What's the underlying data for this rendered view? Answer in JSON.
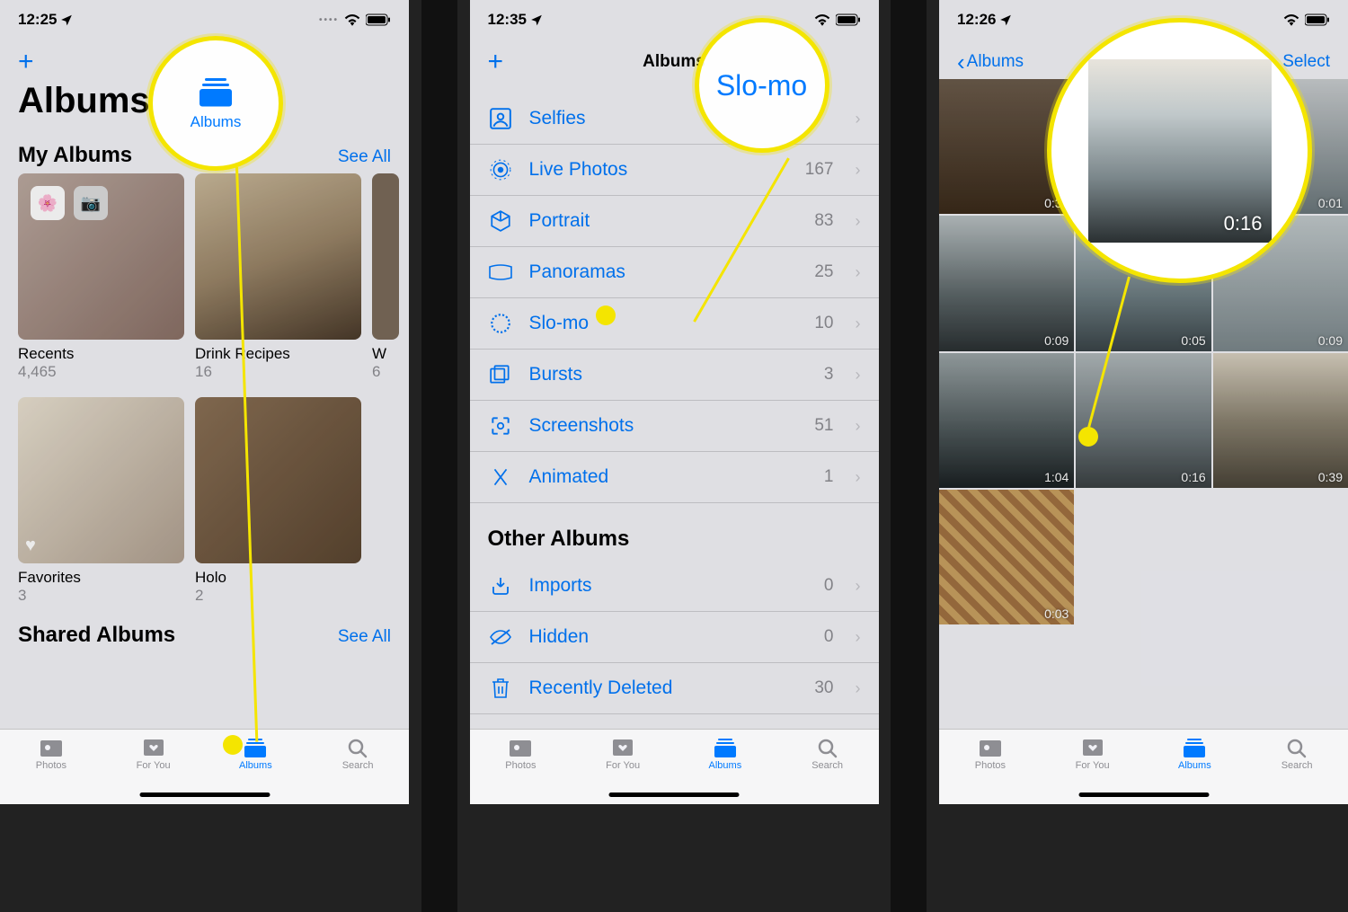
{
  "screens": {
    "s1": {
      "time": "12:25",
      "title": "Albums",
      "nav_add": "+",
      "sections": {
        "my_albums": {
          "title": "My Albums",
          "see_all": "See All"
        },
        "shared": {
          "title": "Shared Albums",
          "see_all": "See All"
        }
      },
      "albums_row1": [
        {
          "name": "Recents",
          "count": "4,465"
        },
        {
          "name": "Drink Recipes",
          "count": "16"
        },
        {
          "name": "W",
          "count": "6"
        }
      ],
      "albums_row2": [
        {
          "name": "Favorites",
          "count": "3"
        },
        {
          "name": "Holo",
          "count": "2"
        }
      ],
      "highlight_label": "Albums"
    },
    "s2": {
      "time": "12:35",
      "nav_title": "Albums",
      "media_types": [
        {
          "label": "Selfies",
          "count": "",
          "icon": "person-square"
        },
        {
          "label": "Live Photos",
          "count": "167",
          "icon": "live"
        },
        {
          "label": "Portrait",
          "count": "83",
          "icon": "cube"
        },
        {
          "label": "Panoramas",
          "count": "25",
          "icon": "pano"
        },
        {
          "label": "Slo-mo",
          "count": "10",
          "icon": "slomo"
        },
        {
          "label": "Bursts",
          "count": "3",
          "icon": "burst"
        },
        {
          "label": "Screenshots",
          "count": "51",
          "icon": "screenshot"
        },
        {
          "label": "Animated",
          "count": "1",
          "icon": "animated"
        }
      ],
      "other_header": "Other Albums",
      "other": [
        {
          "label": "Imports",
          "count": "0",
          "icon": "import"
        },
        {
          "label": "Hidden",
          "count": "0",
          "icon": "hidden"
        },
        {
          "label": "Recently Deleted",
          "count": "30",
          "icon": "trash"
        }
      ],
      "highlight_label": "Slo-mo"
    },
    "s3": {
      "time": "12:26",
      "back": "Albums",
      "select": "Select",
      "highlight_duration": "0:16",
      "thumbs": [
        {
          "dur": "0:37"
        },
        {
          "dur": ""
        },
        {
          "dur": "0:01"
        },
        {
          "dur": "0:09"
        },
        {
          "dur": "0:05"
        },
        {
          "dur": "0:09"
        },
        {
          "dur": "1:04"
        },
        {
          "dur": "0:16"
        },
        {
          "dur": "0:39"
        },
        {
          "dur": "0:03"
        }
      ]
    }
  },
  "tabbar": {
    "photos": "Photos",
    "for_you": "For You",
    "albums": "Albums",
    "search": "Search"
  }
}
